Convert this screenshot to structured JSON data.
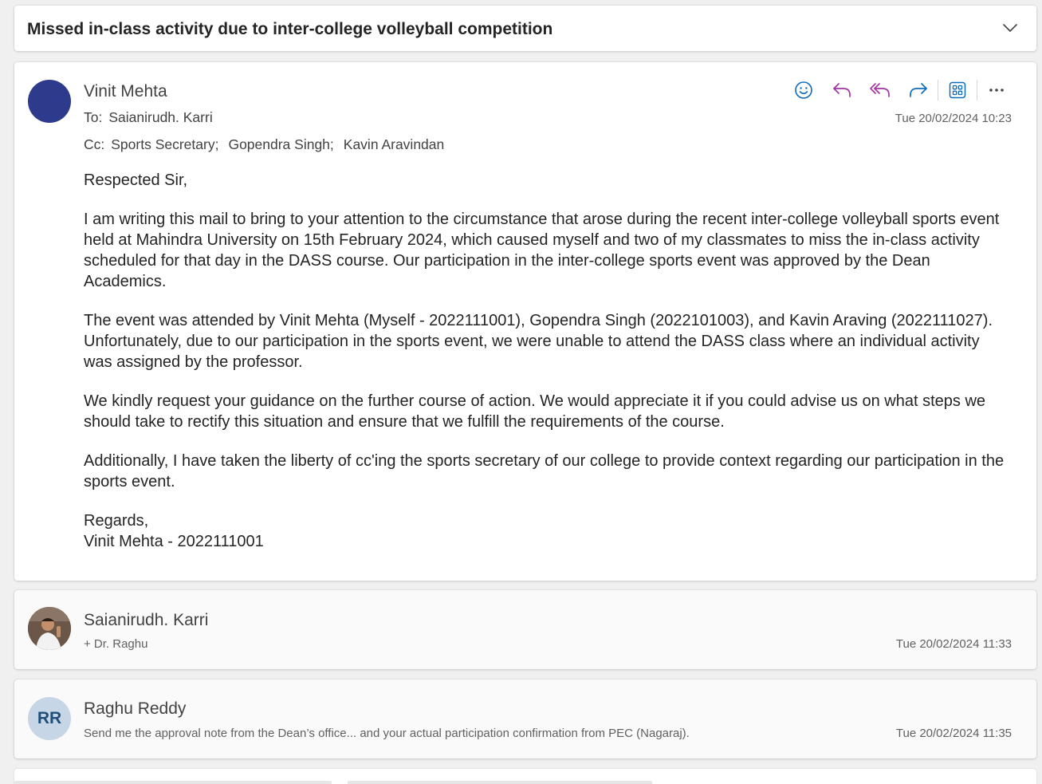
{
  "subject": "Missed in-class activity due to inter-college volleyball competition",
  "message": {
    "sender": "Vinit Mehta",
    "to_label": "To:",
    "to": [
      "Saianirudh. Karri"
    ],
    "cc_label": "Cc:",
    "cc": [
      "Sports Secretary;",
      "Gopendra Singh;",
      "Kavin Aravindan"
    ],
    "timestamp": "Tue 20/02/2024 10:23",
    "actions": [
      "emoji-icon",
      "reply-icon",
      "reply-all-icon",
      "forward-icon",
      "apps-icon",
      "more-icon"
    ],
    "body": [
      "Respected Sir,",
      "I am writing this mail to bring to your attention to the circumstance that arose during the recent inter-college volleyball sports event held at Mahindra University on 15th February 2024, which caused myself and two of my classmates to miss the in-class activity scheduled for that day in the DASS course. Our participation in the inter-college sports event was approved by the Dean Academics.",
      "The event was attended by Vinit Mehta (Myself - 2022111001), Gopendra Singh (2022101003), and Kavin Araving (2022111027). Unfortunately, due to our participation in the sports event, we were unable to attend the DASS class where an individual activity was assigned by the professor.",
      "We kindly request your guidance on the further course of action. We would appreciate it if you could advise us on what steps we should take to rectify this situation and ensure that we fulfill the requirements of the course.",
      "Additionally, I have taken the liberty of cc'ing the sports secretary of our college to provide context regarding our participation in the sports event."
    ],
    "closing": "Regards,",
    "signature": "Vinit Mehta - 2022111001"
  },
  "replies": [
    {
      "sender": "Saianirudh. Karri",
      "snippet": "+ Dr. Raghu",
      "timestamp": "Tue 20/02/2024 11:33"
    },
    {
      "sender": "Raghu Reddy",
      "initials": "RR",
      "snippet": "Send me the approval note from the Dean’s office... and your actual participation confirmation from PEC (Nagaraj).",
      "timestamp": "Tue 20/02/2024 11:35"
    }
  ],
  "colors": {
    "accent_blue": "#0f6cbd",
    "reply_purple": "#a336a3",
    "avatar_navy": "#2e3a8c",
    "avatar_rr_bg": "#c7d6e6"
  }
}
